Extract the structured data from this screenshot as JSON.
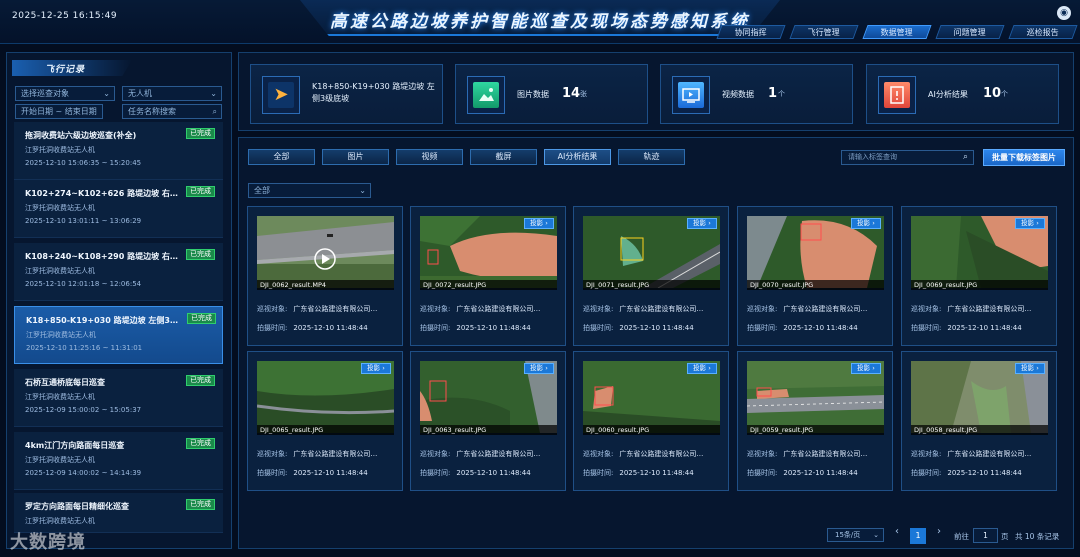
{
  "header": {
    "datetime": "2025-12-25  16:15:49",
    "title": "高速公路边坡养护智能巡查及现场态势感知系统",
    "user_icon": "user-icon",
    "nav": [
      {
        "label": "协同指挥"
      },
      {
        "label": "飞行管理"
      },
      {
        "label": "数据管理",
        "active": true
      },
      {
        "label": "问题管理"
      },
      {
        "label": "巡检报告"
      }
    ]
  },
  "sidebar": {
    "title": "飞行记录",
    "filter_object": "选择巡查对象",
    "filter_drone": "无人机",
    "start_placeholder": "开始日期",
    "date_sep": "~",
    "end_placeholder": "结束日期",
    "task_placeholder": "任务名称搜索",
    "trips": [
      {
        "title": "拖洞收费站六级边坡巡查(补全)",
        "org": "江罗托洞收费站无人机",
        "time": "2025-12-10 15:06:35 ~ 15:20:45",
        "status": "已完成"
      },
      {
        "title": "K102+274~K102+626 路堤边坡 右侧3级…",
        "org": "江罗托洞收费站无人机",
        "time": "2025-12-10 13:01:11 ~ 13:06:29",
        "status": "已完成"
      },
      {
        "title": "K108+240~K108+290 路堤边坡 右侧3级…",
        "org": "江罗托洞收费站无人机",
        "time": "2025-12-10 12:01:18 ~ 12:06:54",
        "status": "已完成"
      },
      {
        "title": "K18+850-K19+030 路堤边坡 左侧3级底坡",
        "org": "江罗托洞收费站无人机",
        "time": "2025-12-10 11:25:16 ~ 11:31:01",
        "status": "已完成",
        "active": true
      },
      {
        "title": "石桥互通桥底每日巡查",
        "org": "江罗托洞收费站无人机",
        "time": "2025-12-09 15:00:02 ~ 15:05:37",
        "status": "已完成"
      },
      {
        "title": "4km江门方向路面每日巡查",
        "org": "江罗托洞收费站无人机",
        "time": "2025-12-09 14:00:02 ~ 14:14:39",
        "status": "已完成"
      },
      {
        "title": "罗定方向路面每日精细化巡查",
        "org": "江罗托洞收费站无人机",
        "time": "",
        "status": "已完成"
      }
    ]
  },
  "stats": {
    "trip_name": "K18+850-K19+030 路堤边坡 左侧3级底坡",
    "images_label": "图片数据",
    "images_value": "14",
    "images_unit": "张",
    "video_label": "视频数据",
    "video_value": "1",
    "video_unit": "个",
    "ai_label": "AI分析结果",
    "ai_value": "10",
    "ai_unit": "个"
  },
  "toolbar": {
    "tabs": [
      {
        "label": "全部"
      },
      {
        "label": "图片"
      },
      {
        "label": "视频"
      },
      {
        "label": "截屏"
      },
      {
        "label": "AI分析结果",
        "active": true
      },
      {
        "label": "轨迹"
      }
    ],
    "search_placeholder": "请输入标签查询",
    "download_label": "批量下载标签图片",
    "filter_value": "全部"
  },
  "cards": [
    {
      "name": "DJI_0062_result.MP4",
      "tag": "",
      "scene": "video",
      "inspect_label": "巡视对象:",
      "inspect_value": "广东省公路建设有限公司…",
      "time_label": "拍摄时间:",
      "time_value": "2025-12-10 11:48:44"
    },
    {
      "name": "DJI_0072_result.JPG",
      "tag": "投影",
      "scene": "slope",
      "inspect_label": "巡视对象:",
      "inspect_value": "广东省公路建设有限公司…",
      "time_label": "拍摄时间:",
      "time_value": "2025-12-10 11:48:44"
    },
    {
      "name": "DJI_0071_result.JPG",
      "tag": "投影",
      "scene": "road",
      "inspect_label": "巡视对象:",
      "inspect_value": "广东省公路建设有限公司…",
      "time_label": "拍摄时间:",
      "time_value": "2025-12-10 11:48:44"
    },
    {
      "name": "DJI_0070_result.JPG",
      "tag": "投影",
      "scene": "slope2",
      "inspect_label": "巡视对象:",
      "inspect_value": "广东省公路建设有限公司…",
      "time_label": "拍摄时间:",
      "time_value": "2025-12-10 11:48:44"
    },
    {
      "name": "DJI_0069_result.JPG",
      "tag": "投影",
      "scene": "slope3",
      "inspect_label": "巡视对象:",
      "inspect_value": "广东省公路建设有限公司…",
      "time_label": "拍摄时间:",
      "time_value": "2025-12-10 11:48:44"
    },
    {
      "name": "DJI_0065_result.JPG",
      "tag": "投影",
      "scene": "forest",
      "inspect_label": "巡视对象:",
      "inspect_value": "广东省公路建设有限公司…",
      "time_label": "拍摄时间:",
      "time_value": "2025-12-10 11:48:44"
    },
    {
      "name": "DJI_0063_result.JPG",
      "tag": "投影",
      "scene": "forest2",
      "inspect_label": "巡视对象:",
      "inspect_value": "广东省公路建设有限公司…",
      "time_label": "拍摄时间:",
      "time_value": "2025-12-10 11:48:44"
    },
    {
      "name": "DJI_0060_result.JPG",
      "tag": "投影",
      "scene": "forest3",
      "inspect_label": "巡视对象:",
      "inspect_value": "广东省公路建设有限公司…",
      "time_label": "拍摄时间:",
      "time_value": "2025-12-10 11:48:44"
    },
    {
      "name": "DJI_0059_result.JPG",
      "tag": "投影",
      "scene": "highway",
      "inspect_label": "巡视对象:",
      "inspect_value": "广东省公路建设有限公司…",
      "time_label": "拍摄时间:",
      "time_value": "2025-12-10 11:48:44"
    },
    {
      "name": "DJI_0058_result.JPG",
      "tag": "投影",
      "scene": "road2",
      "inspect_label": "巡视对象:",
      "inspect_value": "广东省公路建设有限公司…",
      "time_label": "拍摄时间:",
      "time_value": "2025-12-10 11:48:44"
    }
  ],
  "pagination": {
    "page_size": "15条/页",
    "prev": "‹",
    "current": "1",
    "next": "›",
    "goto_label": "前往",
    "goto_value": "1",
    "page_unit": "页",
    "total": "共 10 条记录"
  },
  "watermark": "大数跨境",
  "colors": {
    "accent": "#1b78d8",
    "success": "#1a8a4a",
    "panel": "#06162f"
  }
}
